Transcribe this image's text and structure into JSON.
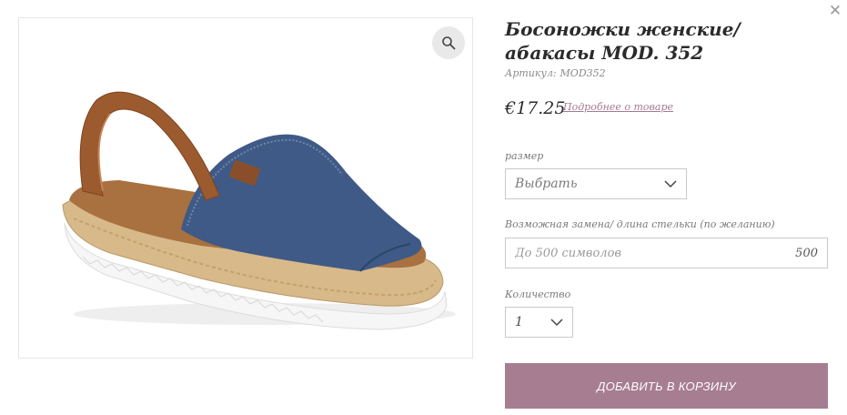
{
  "product": {
    "title": "Босоножки женские/ абакасы MOD. 352",
    "sku_label": "Артикул:",
    "sku_value": "MOD352",
    "price": "€17.25",
    "details_link": "Подробнее о товаре"
  },
  "options": {
    "size_label": "размер",
    "size_value": "Выбрать",
    "replace_label": "Возможная замена/ длина стельки (по желанию)",
    "replace_placeholder": "До 500 символов",
    "replace_counter": "500",
    "qty_label": "Количество",
    "qty_value": "1"
  },
  "cart": {
    "add_button": "ДОБАВИТЬ В КОРЗИНУ"
  },
  "icons": {
    "close": "close-icon",
    "zoom": "magnifier-icon",
    "chevron": "chevron-down-icon"
  },
  "colors": {
    "accent": "#a67d91",
    "link": "#a57a90"
  }
}
